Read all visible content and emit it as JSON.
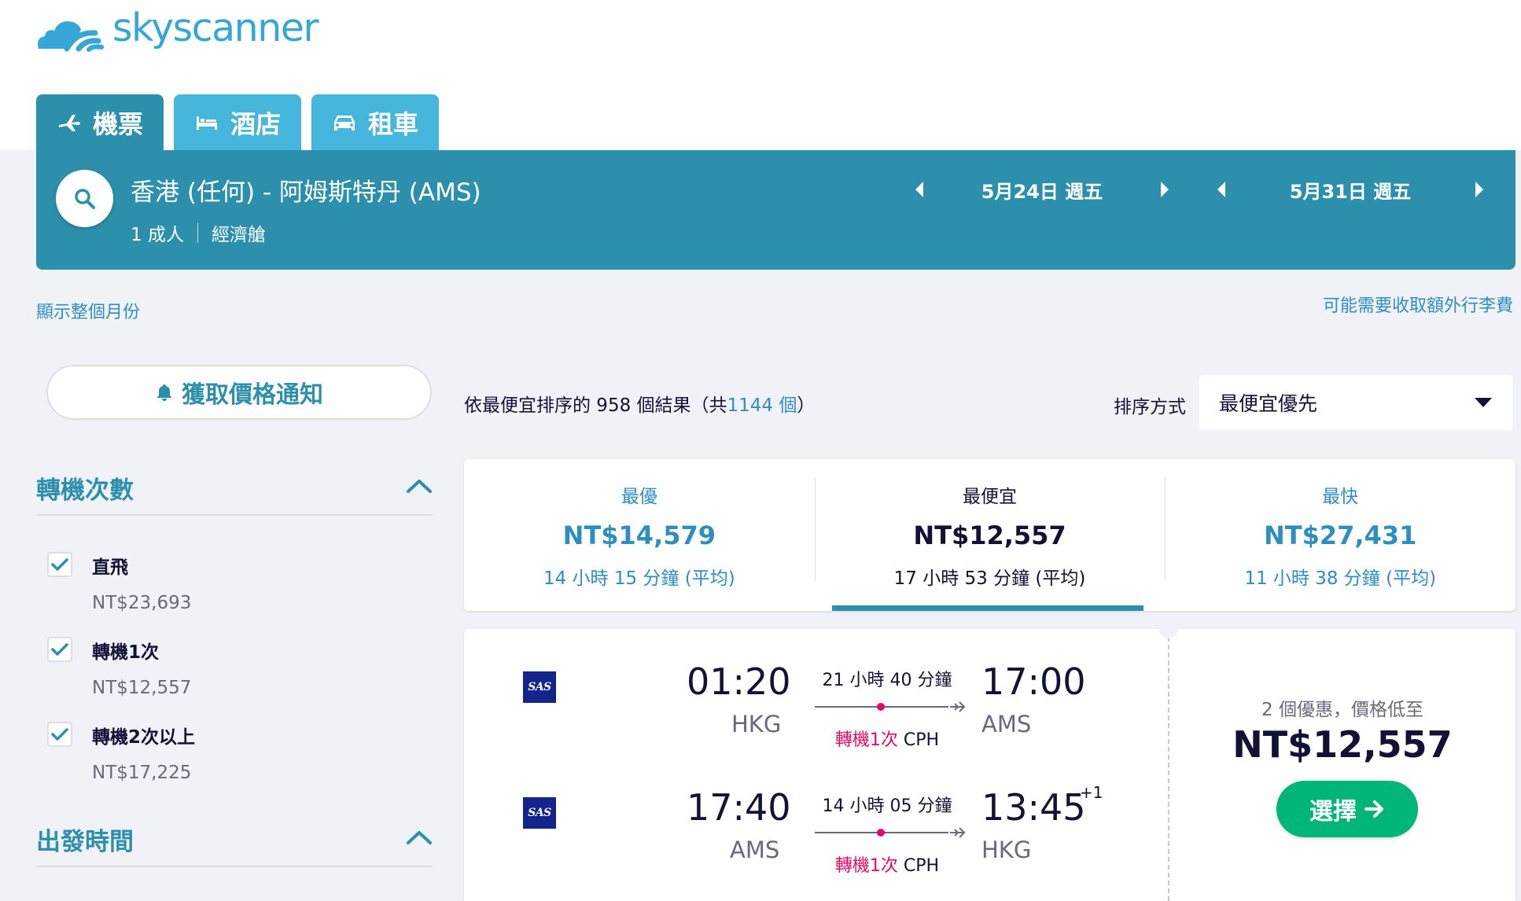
{
  "brand": {
    "name": "skyscanner"
  },
  "tabs": [
    {
      "label": "機票",
      "icon": "plane-icon"
    },
    {
      "label": "酒店",
      "icon": "bed-icon"
    },
    {
      "label": "租車",
      "icon": "car-icon"
    }
  ],
  "search": {
    "route": "香港 (任何) - 阿姆斯特丹 (AMS)",
    "passengers": "1 成人",
    "cabin": "經濟艙",
    "depart_date": "5月24日 週五",
    "return_date": "5月31日 週五"
  },
  "links": {
    "show_month": "顯示整個月份",
    "baggage_fees": "可能需要收取額外行李費"
  },
  "price_alert": {
    "label": "獲取價格通知"
  },
  "filters": {
    "stops": {
      "title": "轉機次數",
      "items": [
        {
          "label": "直飛",
          "price": "NT$23,693",
          "checked": true
        },
        {
          "label": "轉機1次",
          "price": "NT$12,557",
          "checked": true
        },
        {
          "label": "轉機2次以上",
          "price": "NT$17,225",
          "checked": true
        }
      ]
    },
    "departure_time": {
      "title": "出發時間"
    }
  },
  "results": {
    "prefix": "依最便宜排序的 958 個結果（共",
    "total": "1144 個",
    "suffix": "）"
  },
  "sort": {
    "label": "排序方式",
    "value": "最便宜優先"
  },
  "summary": [
    {
      "label": "最優",
      "price": "NT$14,579",
      "duration": "14 小時 15 分鐘 (平均)"
    },
    {
      "label": "最便宜",
      "price": "NT$12,557",
      "duration": "17 小時 53 分鐘 (平均)",
      "active": true
    },
    {
      "label": "最快",
      "price": "NT$27,431",
      "duration": "11 小時 38 分鐘 (平均)"
    }
  ],
  "flight": {
    "legs": [
      {
        "airline": "SAS",
        "depart_time": "01:20",
        "depart_code": "HKG",
        "duration": "21 小時 40 分鐘",
        "stops": "轉機1次",
        "via": "CPH",
        "arrive_time": "17:00",
        "arrive_code": "AMS",
        "plus_day": ""
      },
      {
        "airline": "SAS",
        "depart_time": "17:40",
        "depart_code": "AMS",
        "duration": "14 小時 05 分鐘",
        "stops": "轉機1次",
        "via": "CPH",
        "arrive_time": "13:45",
        "arrive_code": "HKG",
        "plus_day": "+1"
      }
    ],
    "deals_text": "2 個優惠，價格低至",
    "price": "NT$12,557",
    "select_label": "選擇"
  },
  "colors": {
    "primary": "#2c8fab",
    "tab": "#47b6dd",
    "link": "#2f8ec0",
    "cta": "#00b578",
    "stops_red": "#e70866",
    "background": "#f1f2f8"
  }
}
